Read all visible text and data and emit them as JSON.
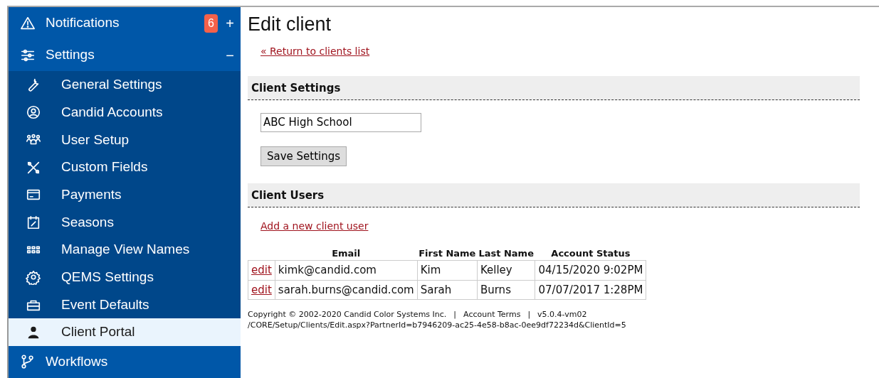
{
  "sidebar": {
    "items": [
      {
        "label": "Notifications",
        "badge": "6",
        "toggle": "+"
      },
      {
        "label": "Settings",
        "toggle": "−",
        "expanded": true,
        "children": [
          {
            "label": "General Settings",
            "selected": false
          },
          {
            "label": "Candid Accounts",
            "selected": false
          },
          {
            "label": "User Setup",
            "selected": false
          },
          {
            "label": "Custom Fields",
            "selected": false
          },
          {
            "label": "Payments",
            "selected": false
          },
          {
            "label": "Seasons",
            "selected": false
          },
          {
            "label": "Manage View Names",
            "selected": false
          },
          {
            "label": "QEMS Settings",
            "selected": false
          },
          {
            "label": "Event Defaults",
            "selected": false
          },
          {
            "label": "Client Portal",
            "selected": true
          }
        ]
      },
      {
        "label": "Workflows"
      }
    ]
  },
  "page": {
    "title": "Edit client",
    "back_link": "« Return to clients list"
  },
  "client_settings": {
    "heading": "Client Settings",
    "name_field": "ABC High School",
    "save_button": "Save Settings"
  },
  "client_users": {
    "heading": "Client Users",
    "add_link": "Add a new client user",
    "table": {
      "columns": [
        "",
        "Email",
        "First Name",
        "Last Name",
        "Account Status"
      ],
      "rows": [
        [
          "edit",
          "kimk@candid.com",
          "Kim",
          "Kelley",
          "04/15/2020 9:02PM"
        ],
        [
          "edit",
          "sarah.burns@candid.com",
          "Sarah",
          "Burns",
          "07/07/2017 1:28PM"
        ]
      ]
    }
  },
  "footer": {
    "parts": [
      "Copyright © 2002-2020 Candid Color Systems Inc.",
      "|",
      "Account Terms",
      "|",
      "v5.0.4-vm02"
    ],
    "path": "/CORE/Setup/Clients/Edit.aspx?PartnerId=b7946209-ac25-4e58-b8ac-0ee9df72234d&ClientId=5"
  }
}
